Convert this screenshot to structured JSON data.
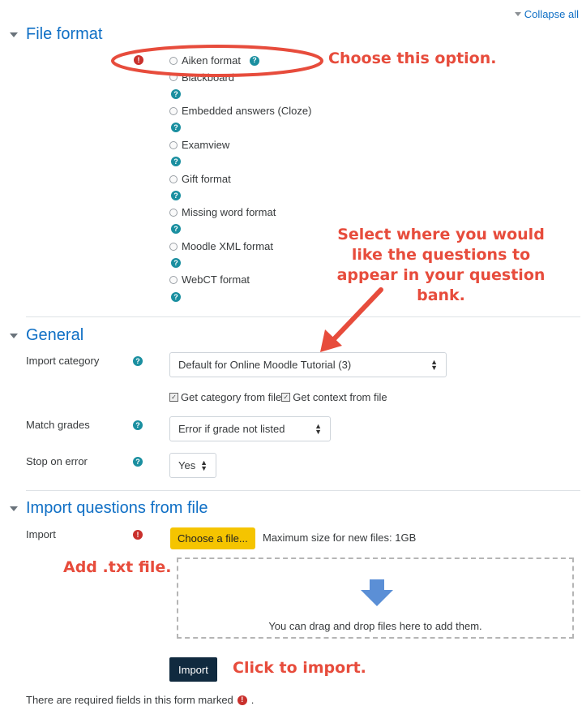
{
  "header": {
    "collapse_all": "Collapse all"
  },
  "sections": {
    "file_format": {
      "title": "File format",
      "options": [
        "Aiken format",
        "Blackboard",
        "Embedded answers (Cloze)",
        "Examview",
        "Gift format",
        "Missing word format",
        "Moodle XML format",
        "WebCT format"
      ]
    },
    "general": {
      "title": "General",
      "import_category": {
        "label": "Import category",
        "value": "Default for Online Moodle Tutorial (3)"
      },
      "checkboxes": [
        "Get category from file",
        "Get context from file"
      ],
      "match_grades": {
        "label": "Match grades",
        "value": "Error if grade not listed"
      },
      "stop_on_error": {
        "label": "Stop on error",
        "value": "Yes"
      }
    },
    "import_file": {
      "title": "Import questions from file",
      "label": "Import",
      "choose_button": "Choose a file...",
      "max_size": "Maximum size for new files: 1GB",
      "drop_text": "You can drag and drop files here to add them.",
      "import_button": "Import"
    }
  },
  "footer": {
    "required_note": "There are required fields in this form marked",
    "period": "."
  },
  "annotations": {
    "choose_option": "Choose this option.",
    "select_where": "Select where you would like the questions to appear in your question bank.",
    "add_txt": "Add .txt file.",
    "click_import": "Click to import."
  },
  "colors": {
    "link": "#0f6fc5",
    "annotation": "#e74c3c",
    "required": "#c9302c",
    "help": "#1a8fa0",
    "choose_button": "#f5c400",
    "import_button": "#102a3f",
    "drop_arrow": "#5b8fd6"
  },
  "icons": [
    "caret-down-icon",
    "required-icon",
    "help-icon",
    "radio-icon",
    "checkbox-icon",
    "select-updown-icon",
    "down-arrow-icon"
  ]
}
